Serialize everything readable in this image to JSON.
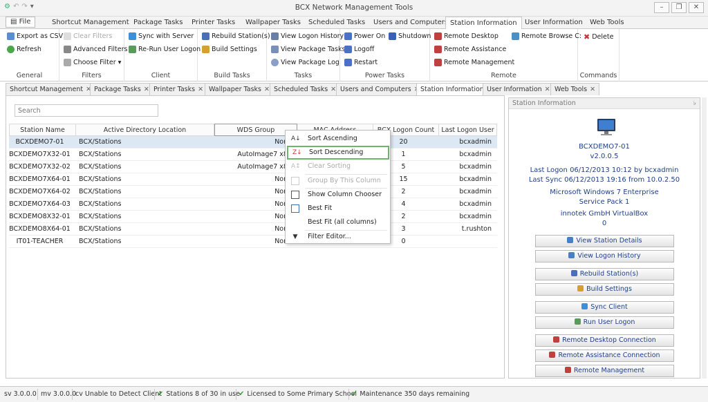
{
  "window": {
    "title": "BCX Network Management Tools"
  },
  "ribbon_tabs": [
    "File",
    "Shortcut Management",
    "Package Tasks",
    "Printer Tasks",
    "Wallpaper Tasks",
    "Scheduled Tasks",
    "Users and Computers",
    "Station Information",
    "User Information",
    "Web Tools"
  ],
  "ribbon": {
    "general": {
      "label": "General",
      "export": "Export as CSV",
      "refresh": "Refresh"
    },
    "filters": {
      "label": "Filters",
      "clear": "Clear Filters",
      "advanced": "Advanced Filters",
      "choose": "Choose Filter"
    },
    "client": {
      "label": "Client",
      "sync": "Sync with Server",
      "rerun": "Re-Run User Logon"
    },
    "build": {
      "label": "Build Tasks",
      "rebuild": "Rebuild Station(s)",
      "settings": "Build Settings"
    },
    "tasks": {
      "label": "Tasks",
      "logon_history": "View Logon History",
      "pkg_tasks": "View Package Tasks",
      "pkg_log": "View Package Log"
    },
    "power": {
      "label": "Power Tasks",
      "power_on": "Power On",
      "shutdown": "Shutdown",
      "logoff": "Logoff",
      "restart": "Restart"
    },
    "remote": {
      "label": "Remote",
      "desktop": "Remote Desktop",
      "browse": "Remote Browse C:",
      "assistance": "Remote Assistance",
      "management": "Remote Management"
    },
    "commands": {
      "label": "Commands",
      "delete": "Delete"
    }
  },
  "doc_tabs": [
    "Shortcut Management",
    "Package Tasks",
    "Printer Tasks",
    "Wallpaper Tasks",
    "Scheduled Tasks",
    "Users and Computers",
    "Station Information",
    "User Information",
    "Web Tools"
  ],
  "search": {
    "placeholder": "Search"
  },
  "grid": {
    "columns": [
      "Station Name",
      "Active Directory Location",
      "WDS Group",
      "MAC Address",
      "BCX Logon Count",
      "Last Logon User"
    ],
    "rows": [
      [
        "BCXDEMO7-01",
        "BCX/Stations",
        "None",
        "",
        "20",
        "bcxadmin"
      ],
      [
        "BCXDEMO7X32-01",
        "BCX/Stations",
        "AutoImage7 x86",
        "",
        "1",
        "bcxadmin"
      ],
      [
        "BCXDEMO7X32-02",
        "BCX/Stations",
        "AutoImage7 x86",
        "",
        "5",
        "bcxadmin"
      ],
      [
        "BCXDEMO7X64-01",
        "BCX/Stations",
        "None",
        "",
        "15",
        "bcxadmin"
      ],
      [
        "BCXDEMO7X64-02",
        "BCX/Stations",
        "None",
        "",
        "2",
        "bcxadmin"
      ],
      [
        "BCXDEMO7X64-03",
        "BCX/Stations",
        "None",
        "",
        "4",
        "bcxadmin"
      ],
      [
        "BCXDEMO8X32-01",
        "BCX/Stations",
        "None",
        "",
        "2",
        "bcxadmin"
      ],
      [
        "BCXDEMO8X64-01",
        "BCX/Stations",
        "None",
        "",
        "3",
        "t.rushton"
      ],
      [
        "IT01-TEACHER",
        "BCX/Stations",
        "None",
        "",
        "0",
        ""
      ]
    ]
  },
  "context_menu": [
    "Sort Ascending",
    "Sort Descending",
    "Clear Sorting",
    "Group By This Column",
    "Show Column Chooser",
    "Best Fit",
    "Best Fit (all columns)",
    "Filter Editor..."
  ],
  "station_panel": {
    "header": "Station Information",
    "name": "BCXDEMO7-01",
    "version": "v2.0.0.5",
    "last_logon": "Last Logon 06/12/2013 10:12 by bcxadmin",
    "last_sync": "Last Sync 06/12/2013 19:16 from 10.0.2.50",
    "os": "Microsoft Windows 7 Enterprise",
    "sp": "Service Pack 1",
    "vendor": "innotek GmbH VirtualBox",
    "count": "0",
    "buttons": [
      "View Station Details",
      "View Logon History",
      "Rebuild Station(s)",
      "Build Settings",
      "Sync Client",
      "Run User Logon",
      "Remote Desktop Connection",
      "Remote Assistance Connection",
      "Remote Management"
    ]
  },
  "status": {
    "sv": "sv 3.0.0.0",
    "mv": "mv 3.0.0.0",
    "cv": "cv Unable to Detect Client",
    "stations": "Stations 8 of 30 in use",
    "license": "Licensed to Some Primary School",
    "maintenance": "Maintenance 350 days remaining"
  },
  "colors": {
    "accent": "#1f3f86",
    "selection": "#dde8f5",
    "highlight_border": "#6db56d",
    "check": "#3c9a3c"
  }
}
